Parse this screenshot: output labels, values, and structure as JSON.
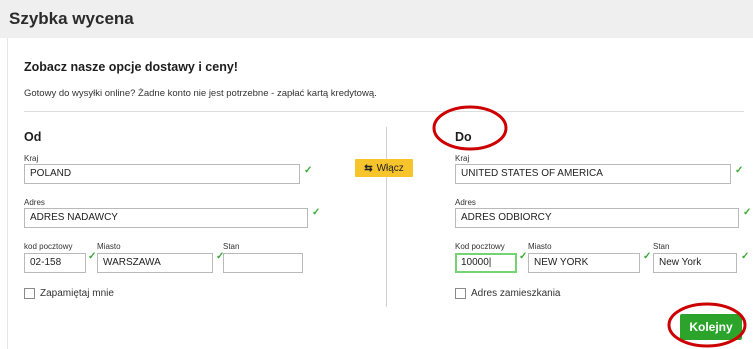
{
  "header": {
    "title": "Szybka wycena"
  },
  "intro": {
    "title": "Zobacz nasze opcje dostawy i ceny!",
    "description": "Gotowy do wysyłki online? Żadne konto nie jest potrzebne - zapłać kartą kredytową."
  },
  "from": {
    "heading": "Od",
    "country_label": "Kraj",
    "country_value": "POLAND",
    "address_label": "Adres",
    "address_value": "ADRES NADAWCY",
    "postal_label": "kod pocztowy",
    "postal_value": "02-158",
    "city_label": "Miasto",
    "city_value": "WARSZAWA",
    "state_label": "Stan",
    "state_value": "",
    "remember_label": "Zapamiętaj mnie"
  },
  "swap": {
    "label": "Włącz",
    "icon": "swap-arrows-icon"
  },
  "to": {
    "heading": "Do",
    "country_label": "Kraj",
    "country_value": "UNITED STATES OF AMERICA",
    "address_label": "Adres",
    "address_value": "ADRES ODBIORCY",
    "postal_label": "Kod pocztowy",
    "postal_value": "10000|",
    "city_label": "Miasto",
    "city_value": "NEW YORK",
    "state_label": "Stan",
    "state_value": "New York",
    "residential_label": "Adres zamieszkania"
  },
  "actions": {
    "next_label": "Kolejny"
  },
  "colors": {
    "accent_green": "#2ca42c",
    "swap_yellow": "#f7c52b",
    "annotation_red": "#cc0000",
    "check_green": "#3aaa35"
  }
}
